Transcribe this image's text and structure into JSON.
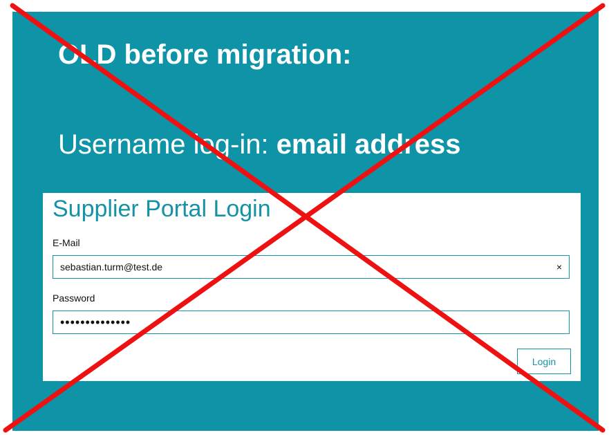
{
  "slide": {
    "heading": "OLD before migration:",
    "subline_prefix": "Username log-in: ",
    "subline_bold": "email address",
    "background_color": "#0e93a7"
  },
  "login": {
    "title": "Supplier Portal Login",
    "email_label": "E-Mail",
    "email_value": "sebastian.turm@test.de",
    "clear_icon": "×",
    "password_label": "Password",
    "password_value": "••••••••••••••",
    "login_button": "Login",
    "accent_color": "#1592a5"
  },
  "overlay": {
    "icon": "red-cross-icon",
    "color": "#ee1111"
  }
}
